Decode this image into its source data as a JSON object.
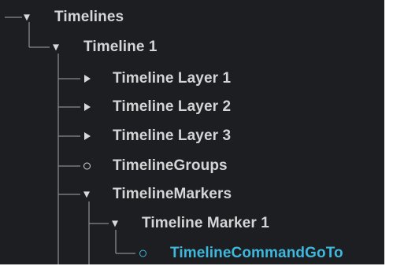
{
  "colors": {
    "panel_background": "#1d1e21",
    "text": "#d4d5d7",
    "connector": "#8a8b8e",
    "selected": "#3eb8dd"
  },
  "tree": {
    "timelines": {
      "label": "Timelines",
      "state": "expanded",
      "icon": "triangle-down"
    },
    "timeline_1": {
      "label": "Timeline 1",
      "state": "expanded",
      "icon": "triangle-down"
    },
    "timeline_layer_1": {
      "label": "Timeline Layer 1",
      "state": "collapsed",
      "icon": "triangle-right"
    },
    "timeline_layer_2": {
      "label": "Timeline Layer 2",
      "state": "collapsed",
      "icon": "triangle-right"
    },
    "timeline_layer_3": {
      "label": "Timeline Layer 3",
      "state": "collapsed",
      "icon": "triangle-right"
    },
    "timeline_groups": {
      "label": "TimelineGroups",
      "state": "leaf",
      "icon": "circle"
    },
    "timeline_markers": {
      "label": "TimelineMarkers",
      "state": "expanded",
      "icon": "triangle-down"
    },
    "timeline_marker_1": {
      "label": "Timeline Marker 1",
      "state": "expanded",
      "icon": "triangle-down"
    },
    "timeline_command_goto": {
      "label": "TimelineCommandGoTo",
      "state": "leaf",
      "icon": "circle",
      "selected": true
    }
  }
}
